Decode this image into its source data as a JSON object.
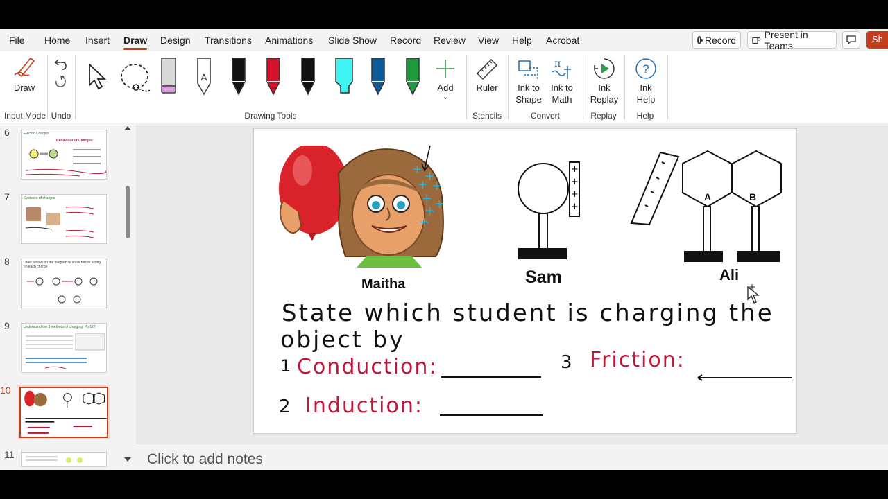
{
  "menu": {
    "tabs": [
      "File",
      "Home",
      "Insert",
      "Draw",
      "Design",
      "Transitions",
      "Animations",
      "Slide Show",
      "Record",
      "Review",
      "View",
      "Help",
      "Acrobat"
    ],
    "record_label": "Record",
    "present_label": "Present in Teams",
    "share_label": "Sh"
  },
  "ribbon": {
    "draw_label": "Draw",
    "add_label": "Add",
    "ruler_label": "Ruler",
    "ink_to_shape": "Ink to\nShape",
    "ink_to_math": "Ink to\nMath",
    "ink_replay": "Ink\nReplay",
    "ink_help": "Ink\nHelp",
    "groups": {
      "input_mode": "Input Mode",
      "undo": "Undo",
      "drawing_tools": "Drawing Tools",
      "stencils": "Stencils",
      "convert": "Convert",
      "replay": "Replay",
      "help": "Help"
    },
    "pen_colors": [
      "#111111",
      "#d4132b",
      "#111111",
      "#3ff3f3",
      "#0d5a9a",
      "#1f9a3c"
    ]
  },
  "thumbnails": [
    {
      "num": "6",
      "title": "Electric Charges",
      "sub": "Behaviour of Charges:"
    },
    {
      "num": "7",
      "title": "Evidence of charges",
      "sub": ""
    },
    {
      "num": "8",
      "title": "Draw arrows on the diagram to show forces acting on each charge",
      "sub": ""
    },
    {
      "num": "9",
      "title": "Understand the 3 methods of charging, Pp 127",
      "sub": ""
    },
    {
      "num": "10",
      "title": "",
      "sub": ""
    },
    {
      "num": "11",
      "title": "",
      "sub": ""
    }
  ],
  "slide": {
    "names": {
      "maitha": "Maitha",
      "sam": "Sam",
      "ali": "Ali",
      "a": "A",
      "b": "B"
    },
    "question_line1": "State which student is charging the",
    "question_line2": "object by",
    "q1_num": "1",
    "q1_text": "Conduction:",
    "q2_num": "2",
    "q2_text": "Induction:",
    "q3_num": "3",
    "q3_text": "Friction:",
    "ink_color": "#c0163a"
  },
  "notes": {
    "placeholder": "Click to add notes"
  }
}
